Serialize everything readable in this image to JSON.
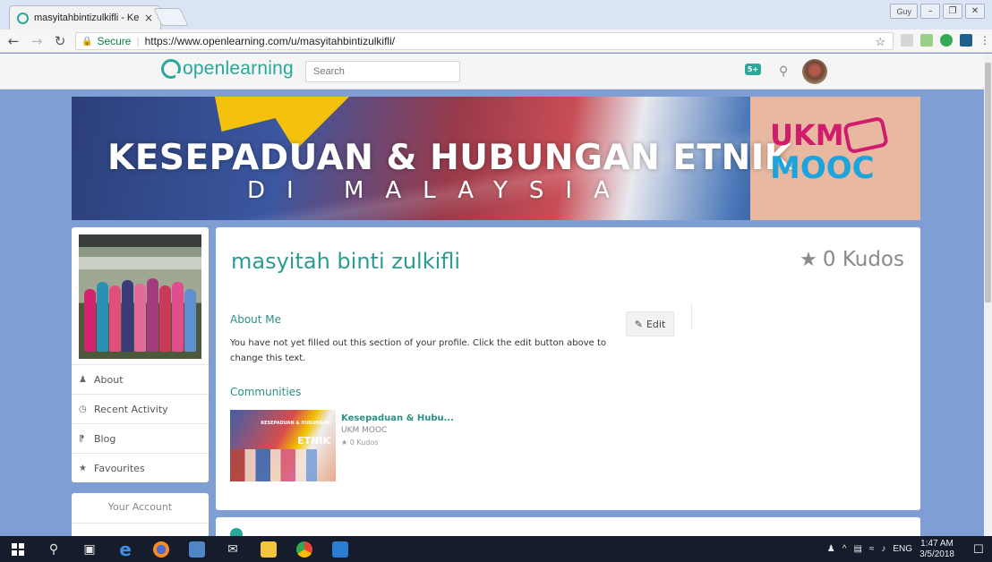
{
  "browser": {
    "tab_title": "masyitahbintizulkifli - Ke",
    "tab_close": "×",
    "user_chip": "Guy",
    "secure_label": "Secure",
    "url": "https://www.openlearning.com/u/masyitahbintizulkifli/"
  },
  "site": {
    "logo_text": "openlearning",
    "search_placeholder": "Search",
    "message_badge": "5+"
  },
  "banner": {
    "title": "KESEPADUAN & HUBUNGAN ETNIK",
    "subtitle": "DI MALAYSIA",
    "logo_top": "UKM",
    "logo_bottom": "MOOC"
  },
  "sidebar": {
    "items": [
      {
        "icon": "user-icon",
        "label": "About"
      },
      {
        "icon": "clock-icon",
        "label": "Recent Activity"
      },
      {
        "icon": "rss-icon",
        "label": "Blog"
      },
      {
        "icon": "star-icon",
        "label": "Favourites"
      }
    ],
    "account_title": "Your Account"
  },
  "profile": {
    "name": "masyitah binti zulkifli",
    "kudos": "0 Kudos",
    "about_title": "About Me",
    "about_text": "You have not yet filled out this section of your profile. Click the edit button above to change this text.",
    "edit_label": "Edit",
    "communities_title": "Communities",
    "community": {
      "name": "Kesepaduan & Hubu...",
      "org": "UKM MOOC",
      "kudos": "0 Kudos",
      "thumb_small": "KESEPADUAN & HUBUNGAN",
      "thumb_big": "ETNIK"
    }
  },
  "taskbar": {
    "language": "ENG",
    "time": "1:47 AM",
    "date": "3/5/2018"
  },
  "colors": {
    "accent": "#2a9c91",
    "page_bg": "#7f9fd4"
  }
}
